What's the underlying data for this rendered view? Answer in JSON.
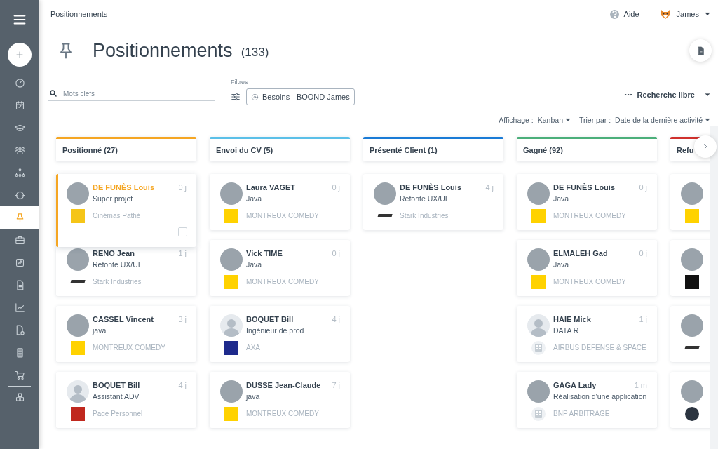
{
  "sidebar": {
    "items": [
      {
        "kind": "gauge",
        "selected": false
      },
      {
        "kind": "calendar",
        "selected": false
      },
      {
        "kind": "graduation",
        "selected": false
      },
      {
        "kind": "people",
        "selected": false
      },
      {
        "kind": "hierarchy",
        "selected": false
      },
      {
        "kind": "crosshair",
        "selected": false
      },
      {
        "kind": "pin",
        "selected": true
      },
      {
        "kind": "briefcase",
        "selected": false
      },
      {
        "kind": "pencil",
        "selected": false
      },
      {
        "kind": "document",
        "selected": false
      },
      {
        "kind": "chart",
        "selected": false
      },
      {
        "kind": "invoice",
        "selected": false
      },
      {
        "kind": "calculator",
        "selected": false
      },
      {
        "kind": "cart",
        "selected": false
      },
      {
        "kind": "boxes",
        "selected": false
      }
    ]
  },
  "topbar": {
    "breadcrumb": "Positionnements",
    "help": "Aide",
    "user": "James"
  },
  "header": {
    "title": "Positionnements",
    "count": "(133)"
  },
  "toolbar": {
    "search": {
      "placeholder": "Mots clefs"
    },
    "filters_label": "Filtres",
    "filter_chip": "Besoins - BOOND James",
    "free_search": "Recherche libre"
  },
  "view": {
    "display_label": "Affichage :",
    "display_value": "Kanban",
    "sort_label": "Trier par :",
    "sort_value": "Date de la dernière activité"
  },
  "columns": [
    {
      "title": "Positionné (27)",
      "color": "#f5a623",
      "cards": [
        {
          "name": "DE FUNÈS Louis",
          "subtitle": "Super projet",
          "age": "0 j",
          "company": "Cinémas Pathé",
          "avatar": {
            "kind": "photo"
          },
          "logo": {
            "kind": "square",
            "color": "#f5c518"
          },
          "selected": true,
          "checked": false
        },
        {
          "name": "RENO Jean",
          "subtitle": "Refonte UX/UI",
          "age": "1 j",
          "company": "Stark Industries",
          "avatar": {
            "kind": "photo"
          },
          "logo": {
            "kind": "wordmark",
            "color": "#333333"
          },
          "selected": false
        },
        {
          "name": "CASSEL Vincent",
          "subtitle": "java",
          "age": "3 j",
          "company": "MONTREUX COMEDY",
          "avatar": {
            "kind": "photo"
          },
          "logo": {
            "kind": "square",
            "color": "#ffd200"
          },
          "selected": false
        },
        {
          "name": "BOQUET Bill",
          "subtitle": "Assistant ADV",
          "age": "4 j",
          "company": "Page Personnel",
          "avatar": {
            "kind": "placeholder"
          },
          "logo": {
            "kind": "square",
            "color": "#c0281e"
          },
          "selected": false
        }
      ]
    },
    {
      "title": "Envoi du CV (5)",
      "color": "#5bc0e8",
      "cards": [
        {
          "name": "Laura VAGET",
          "subtitle": "Java",
          "age": "0 j",
          "company": "MONTREUX COMEDY",
          "avatar": {
            "kind": "photo"
          },
          "logo": {
            "kind": "square",
            "color": "#ffd200"
          },
          "selected": false
        },
        {
          "name": "Vick TIME",
          "subtitle": "Java",
          "age": "0 j",
          "company": "MONTREUX COMEDY",
          "avatar": {
            "kind": "photo"
          },
          "logo": {
            "kind": "square",
            "color": "#ffd200"
          },
          "selected": false
        },
        {
          "name": "BOQUET Bill",
          "subtitle": "Ingénieur de prod",
          "age": "4 j",
          "company": "AXA",
          "avatar": {
            "kind": "placeholder"
          },
          "logo": {
            "kind": "square",
            "color": "#1e2a8c"
          },
          "selected": false
        },
        {
          "name": "DUSSE Jean-Claude",
          "subtitle": "java",
          "age": "7 j",
          "company": "MONTREUX COMEDY",
          "avatar": {
            "kind": "photo"
          },
          "logo": {
            "kind": "square",
            "color": "#ffd200"
          },
          "selected": false
        }
      ]
    },
    {
      "title": "Présenté Client (1)",
      "color": "#1a7bd6",
      "cards": [
        {
          "name": "DE FUNÈS Louis",
          "subtitle": "Refonte UX/UI",
          "age": "4 j",
          "company": "Stark Industries",
          "avatar": {
            "kind": "photo"
          },
          "logo": {
            "kind": "wordmark",
            "color": "#333333"
          },
          "selected": false
        }
      ]
    },
    {
      "title": "Gagné (92)",
      "color": "#4caf7a",
      "cards": [
        {
          "name": "DE FUNÈS Louis",
          "subtitle": "Java",
          "age": "0 j",
          "company": "MONTREUX COMEDY",
          "avatar": {
            "kind": "photo"
          },
          "logo": {
            "kind": "square",
            "color": "#ffd200"
          },
          "selected": false
        },
        {
          "name": "ELMALEH Gad",
          "subtitle": "Java",
          "age": "0 j",
          "company": "MONTREUX COMEDY",
          "avatar": {
            "kind": "photo"
          },
          "logo": {
            "kind": "square",
            "color": "#ffd200"
          },
          "selected": false
        },
        {
          "name": "HAIE Mick",
          "subtitle": "DATA R",
          "age": "1 j",
          "company": "AIRBUS DEFENSE & SPACE",
          "avatar": {
            "kind": "placeholder"
          },
          "logo": {
            "kind": "building",
            "color": "#c5cdd4"
          },
          "selected": false
        },
        {
          "name": "GAGA Lady",
          "subtitle": "Réalisation d'une application",
          "age": "1 m",
          "company": "BNP ARBITRAGE",
          "avatar": {
            "kind": "photo"
          },
          "logo": {
            "kind": "building",
            "color": "#c5cdd4"
          },
          "selected": false
        }
      ]
    },
    {
      "title": "Refu",
      "color": "#d0312d",
      "cards": [
        {
          "avatar": {
            "kind": "photo"
          },
          "logo": {
            "kind": "square",
            "color": "#ffd200"
          },
          "selected": false
        },
        {
          "avatar": {
            "kind": "photo"
          },
          "logo": {
            "kind": "square",
            "color": "#111111"
          },
          "selected": false
        },
        {
          "avatar": {
            "kind": "photo"
          },
          "logo": {
            "kind": "wordmark",
            "color": "#333333"
          },
          "selected": false
        },
        {
          "avatar": {
            "kind": "photo"
          },
          "logo": {
            "kind": "round",
            "color": "#2b3440"
          },
          "selected": false
        }
      ]
    }
  ]
}
